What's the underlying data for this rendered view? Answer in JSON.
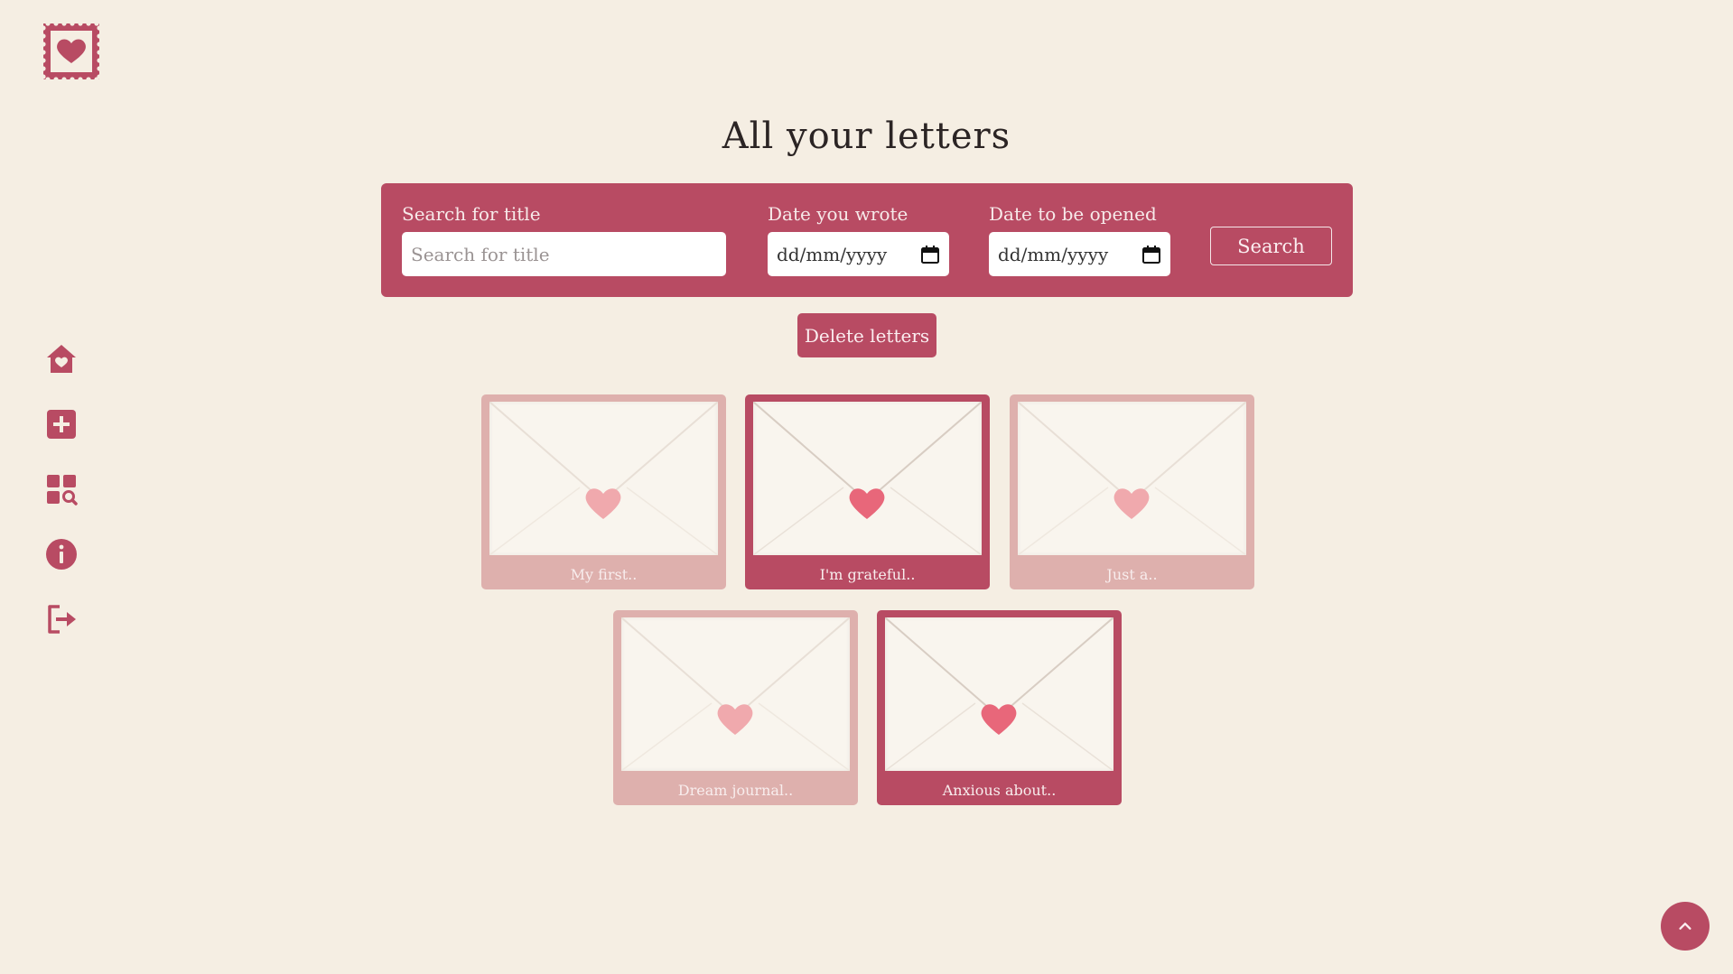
{
  "app": {
    "logo_icon": "heart-stamp-icon",
    "accent_color": "#b84b63",
    "light_card_color": "#deb0ad",
    "background_color": "#f5eee3"
  },
  "sidebar": {
    "items": [
      {
        "icon": "home-heart-icon",
        "label": "Home"
      },
      {
        "icon": "add-icon",
        "label": "New letter"
      },
      {
        "icon": "grid-search-icon",
        "label": "All letters"
      },
      {
        "icon": "info-icon",
        "label": "About"
      },
      {
        "icon": "logout-icon",
        "label": "Log out"
      }
    ]
  },
  "header": {
    "title": "All your letters"
  },
  "search": {
    "title_label": "Search for title",
    "title_placeholder": "Search for title",
    "wrote_label": "Date you wrote",
    "wrote_placeholder": "dd/mm/yyyy",
    "open_label": "Date to be opened",
    "open_placeholder": "dd/mm/yyyy",
    "search_button": "Search"
  },
  "actions": {
    "delete_button": "Delete letters"
  },
  "letters": [
    {
      "title": "My first..",
      "style": "light"
    },
    {
      "title": "I'm grateful..",
      "style": "dark"
    },
    {
      "title": "Just a..",
      "style": "light"
    },
    {
      "title": "Dream journal..",
      "style": "light"
    },
    {
      "title": "Anxious about..",
      "style": "dark"
    }
  ],
  "scroll_top_icon": "chevron-up-icon"
}
